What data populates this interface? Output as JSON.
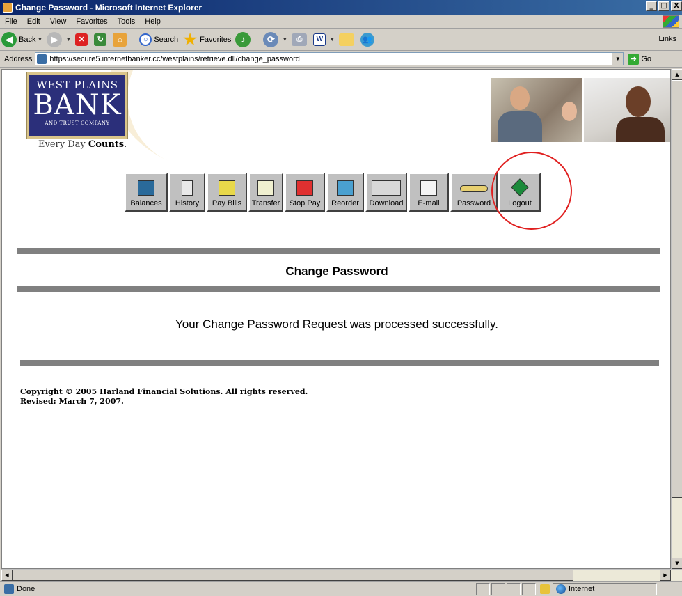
{
  "window": {
    "title": "Change Password - Microsoft Internet Explorer",
    "buttons": [
      "_",
      "□",
      "X"
    ]
  },
  "menu": [
    "File",
    "Edit",
    "View",
    "Favorites",
    "Tools",
    "Help"
  ],
  "toolbar": {
    "back_label": "Back",
    "search_label": "Search",
    "favorites_label": "Favorites",
    "links_label": "Links"
  },
  "address": {
    "label": "Address",
    "url": "https://secure5.internetbanker.cc/westplains/retrieve.dll/change_password",
    "go_label": "Go"
  },
  "bank": {
    "logo_line1": "WEST PLAINS",
    "logo_line2": "BANK",
    "logo_line3": "AND TRUST COMPANY",
    "tagline_prefix": "Every Day ",
    "tagline_bold": "Counts",
    "tagline_suffix": "."
  },
  "nav": {
    "items": [
      {
        "label": "Balances",
        "icon": "balances-icon",
        "color": "#2a6a9a"
      },
      {
        "label": "History",
        "icon": "history-icon",
        "color": "#e8e8e8"
      },
      {
        "label": "Pay Bills",
        "icon": "pay-bills-icon",
        "color": "#e8d84a"
      },
      {
        "label": "Transfer",
        "icon": "transfer-icon",
        "color": "#f0f0d0"
      },
      {
        "label": "Stop Pay",
        "icon": "stop-pay-icon",
        "color": "#e03030"
      },
      {
        "label": "Reorder",
        "icon": "reorder-icon",
        "color": "#4aa0d0"
      },
      {
        "label": "Download",
        "icon": "download-icon",
        "color": "#d8d8d8"
      },
      {
        "label": "E-mail",
        "icon": "email-icon",
        "color": "#f4f4f4"
      },
      {
        "label": "Password",
        "icon": "key-icon",
        "color": "#e8d070"
      },
      {
        "label": "Logout",
        "icon": "logout-icon",
        "color": "#1a8a3a"
      }
    ]
  },
  "content": {
    "heading": "Change Password",
    "message": "Your Change Password Request was processed successfully.",
    "copyright": "Copyright © 2005 Harland Financial Solutions.  All rights reserved.",
    "revised": "Revised: March 7, 2007."
  },
  "status": {
    "text": "Done",
    "zone": "Internet"
  }
}
